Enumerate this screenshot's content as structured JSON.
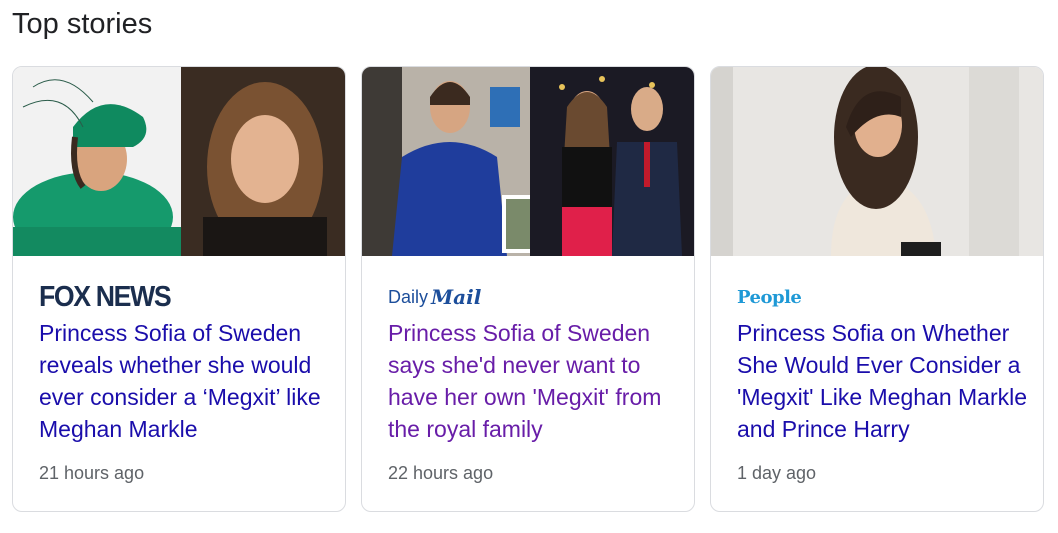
{
  "section": {
    "title": "Top stories"
  },
  "cards": [
    {
      "publisher": "FOX NEWS",
      "headline": "Princess Sofia of Sweden reveals whether she would ever consider a ‘Megxit’ like Meghan Markle",
      "time": "21 hours ago",
      "visited": false
    },
    {
      "publisher_part1": "Daily",
      "publisher_part2": "Mail",
      "headline": "Princess Sofia of Sweden says she'd never want to have her own 'Megxit' from the royal family",
      "time": "22 hours ago",
      "visited": true
    },
    {
      "publisher": "People",
      "headline": "Princess Sofia on Whether She Would Ever Consider a 'Megxit' Like Meghan Markle and Prince Harry",
      "time": "1 day ago",
      "visited": false
    }
  ],
  "colors": {
    "link": "#1a0dab",
    "visited": "#681da8",
    "meta": "#5f6368",
    "border": "#dadce0"
  }
}
